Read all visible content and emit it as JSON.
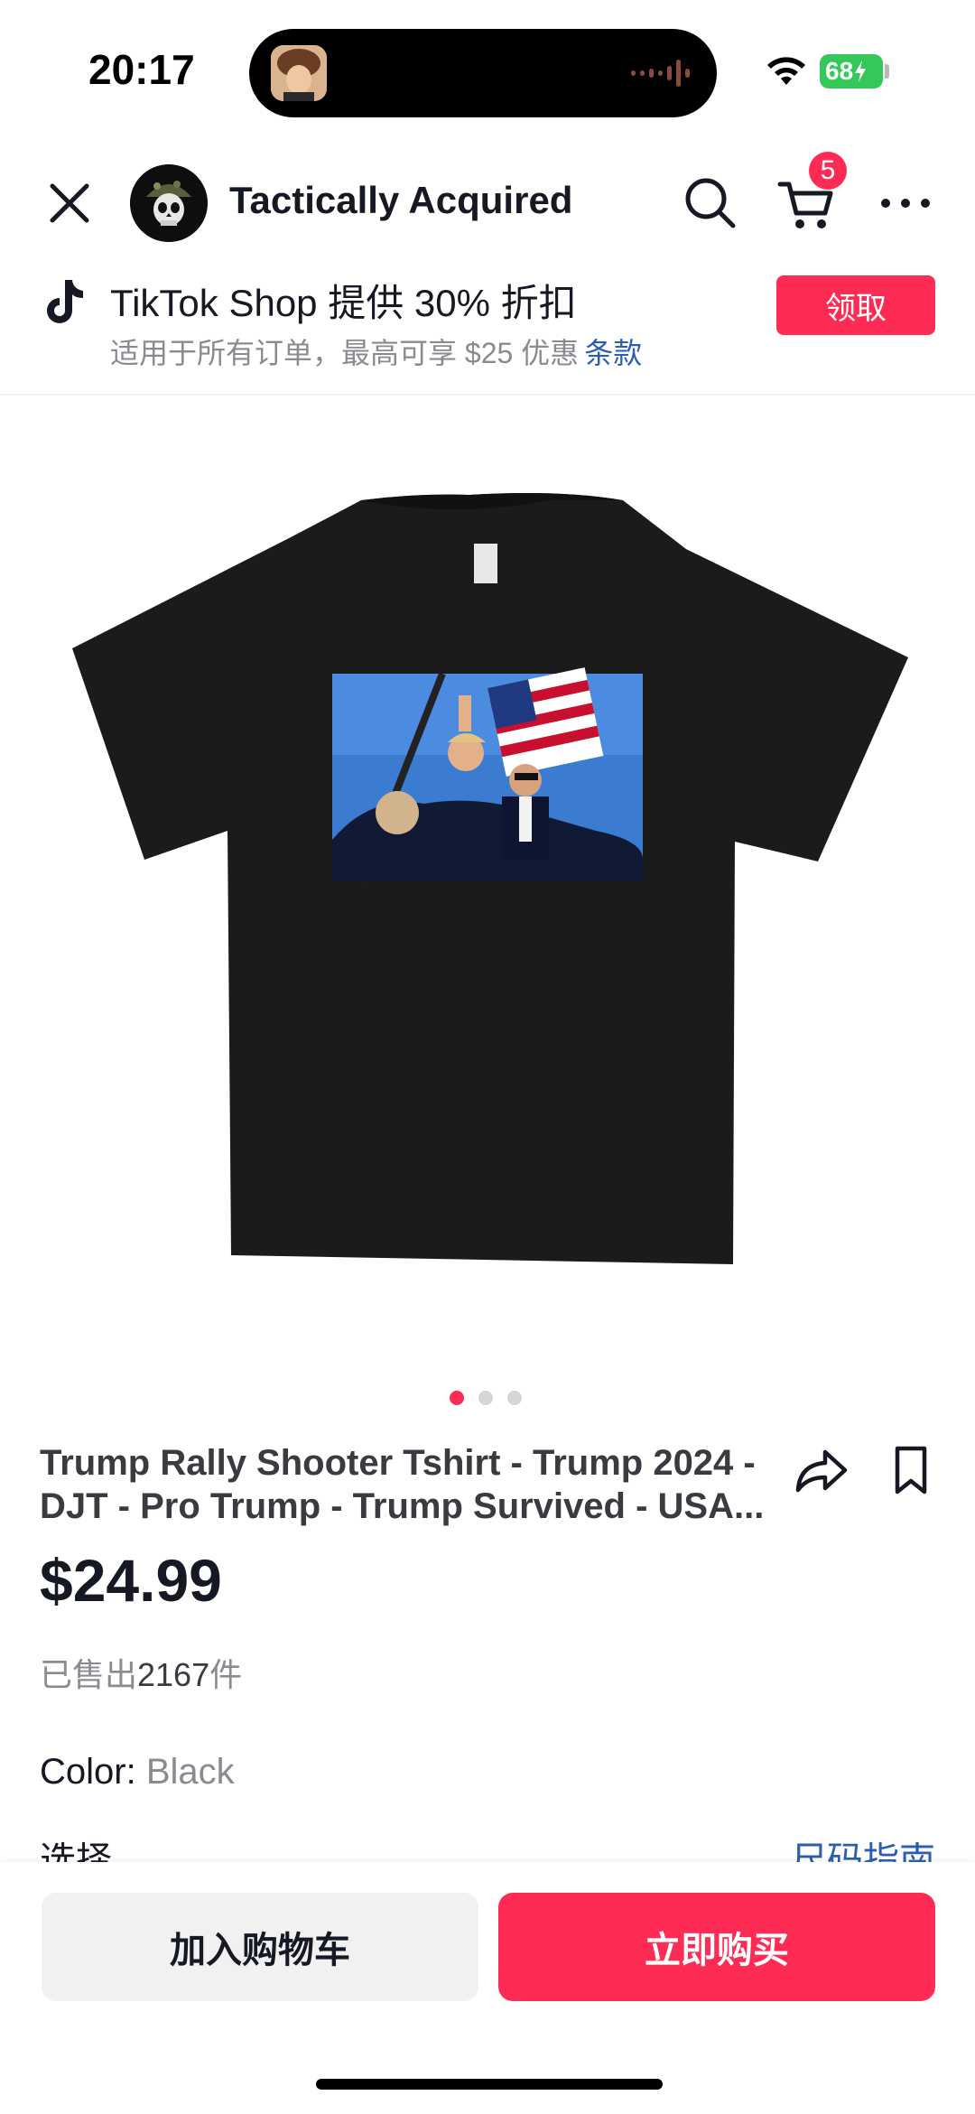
{
  "status_bar": {
    "time": "20:17",
    "battery": "68",
    "icons": [
      "wifi-icon",
      "battery-charging-icon"
    ]
  },
  "header": {
    "shop_name": "Tactically Acquired",
    "cart_count": "5",
    "icons": [
      "close-icon",
      "search-icon",
      "cart-icon",
      "more-icon"
    ]
  },
  "promo": {
    "title": "TikTok Shop 提供 30% 折扣",
    "subtitle": "适用于所有订单，最高可享 $25 优惠",
    "terms_link": "条款",
    "claim_button": "领取"
  },
  "gallery": {
    "total_images": 3,
    "active_index": 0
  },
  "product": {
    "title": "Trump Rally Shooter Tshirt - Trump 2024 - DJT - Pro Trump - Trump Survived - USA...",
    "price": "$24.99",
    "sold_prefix": "已售出",
    "sold_count": "2167",
    "sold_suffix": "件",
    "color_label": "Color:",
    "color_value": "Black",
    "select_label": "选择",
    "size_guide_link": "尺码指南"
  },
  "actions": {
    "add_to_cart": "加入购物车",
    "buy_now": "立即购买"
  },
  "colors": {
    "accent": "#fe2c55",
    "link": "#2b5db3",
    "shirt": "#1b1b1b",
    "battery": "#34c759"
  }
}
